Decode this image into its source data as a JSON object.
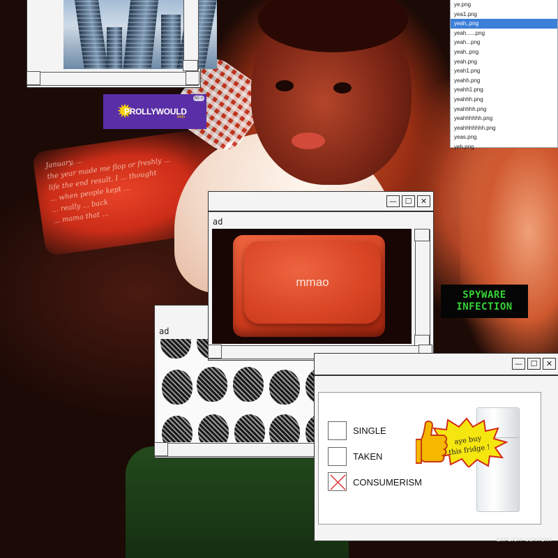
{
  "file_list": {
    "items": [
      "ye.png",
      "yea1.png",
      "yeah,.png",
      "yeah......png",
      "yeah...png",
      "yeah..png",
      "yeah.png",
      "yeah1.png",
      "yeahh.png",
      "yeahh1.png",
      "yeahhh.png",
      "yeahhhh.png",
      "yeahhhhhh.png",
      "yeahhhhhhh.png",
      "yeas.png",
      "yeh.png"
    ],
    "selected_index": 2
  },
  "prolly_ad": {
    "brand": "PROLLYWOULD",
    "sub": "bets",
    "badge": "AD ✕"
  },
  "spyware": {
    "line1": "SPYWARE",
    "line2": "INFECTION"
  },
  "keycap_window": {
    "label": "ad",
    "key_text": "mmao",
    "min": "—",
    "max": "☐",
    "close": "✕"
  },
  "braids_window": {
    "label": "ad"
  },
  "fridge_window": {
    "min": "—",
    "max": "☐",
    "close": "✕",
    "options": [
      {
        "label": "SINGLE",
        "checked": false
      },
      {
        "label": "TAKEN",
        "checked": false
      },
      {
        "label": "CONSUMERISM",
        "checked": true
      }
    ],
    "bubble_line1": "aye buy",
    "bubble_line2": "this fridge !"
  },
  "note_text": [
    "January, ...",
    "the year made me flop or freshly ...",
    "life the end result, I ... thought",
    "... when people kept ...",
    "... really ... back",
    "... mama that ..."
  ],
  "footer": {
    "explicit": "EXPLICIT CONTENT"
  },
  "colors": {
    "selection": "#3c7fd8",
    "spyware_green": "#37d237",
    "key_red": "#d84524",
    "ad_purple": "#5a2ea6"
  }
}
